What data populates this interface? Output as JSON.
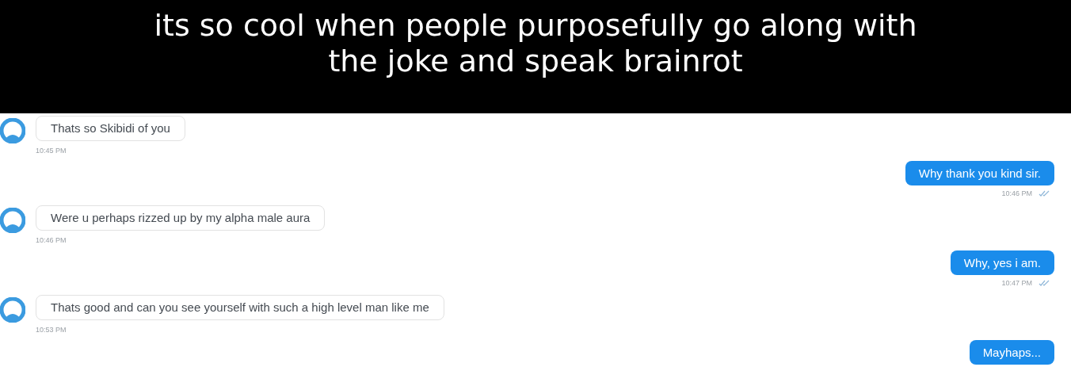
{
  "caption": "its so cool when people purposefully go along with the joke and speak brainrot",
  "messages": [
    {
      "kind": "incoming",
      "text": "Thats so Skibidi of you",
      "time": "10:45 PM"
    },
    {
      "kind": "outgoing",
      "text": "Why thank you kind sir.",
      "time": "10:46 PM",
      "read": true
    },
    {
      "kind": "incoming",
      "text": "Were u perhaps rizzed up by my alpha male aura",
      "time": "10:46 PM"
    },
    {
      "kind": "outgoing",
      "text": "Why, yes i am.",
      "time": "10:47 PM",
      "read": true
    },
    {
      "kind": "incoming",
      "text": "Thats good and can you see yourself with such a high level man like me",
      "time": "10:53 PM"
    },
    {
      "kind": "outgoing",
      "text": "Mayhaps..."
    }
  ]
}
